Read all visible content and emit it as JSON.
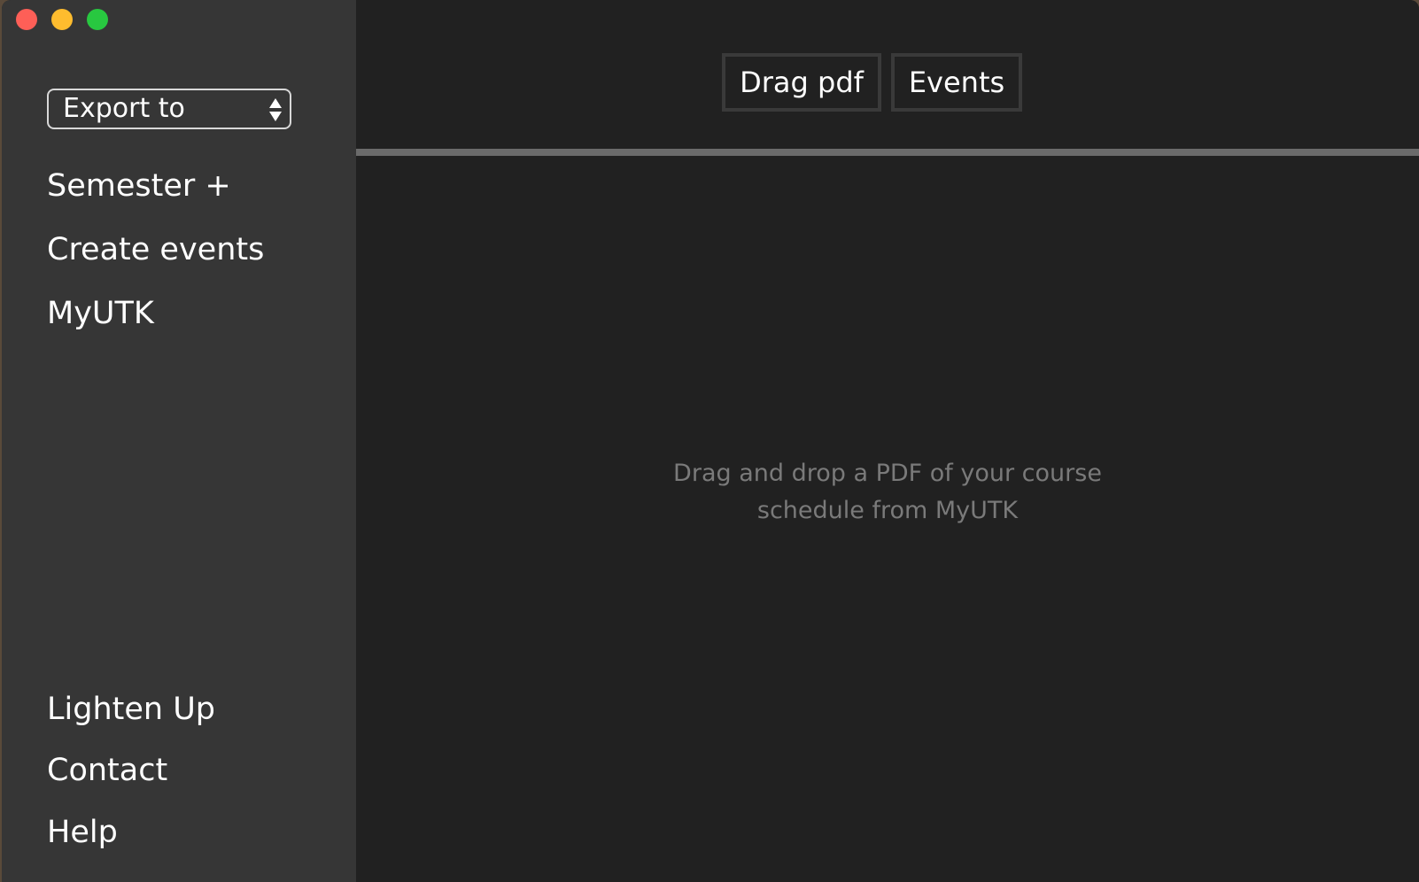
{
  "window": {
    "traffic_lights": [
      {
        "name": "close",
        "color": "#fe5f57"
      },
      {
        "name": "minimize",
        "color": "#febc2e"
      },
      {
        "name": "zoom",
        "color": "#28c840"
      }
    ]
  },
  "sidebar": {
    "export_select": {
      "label": "Export to"
    },
    "top_items": [
      {
        "label": "Semester +"
      },
      {
        "label": "Create events"
      },
      {
        "label": "MyUTK"
      }
    ],
    "bottom_items": [
      {
        "label": "Lighten Up"
      },
      {
        "label": "Contact"
      },
      {
        "label": "Help"
      }
    ]
  },
  "main": {
    "tabs": [
      {
        "label": "Drag pdf"
      },
      {
        "label": "Events"
      }
    ],
    "drop_hint": {
      "line1": "Drag and drop a PDF of your course",
      "line2": "schedule from MyUTK"
    }
  },
  "colors": {
    "sidebar_bg": "#363636",
    "main_bg": "#212121",
    "divider": "#6b6b6b",
    "hint_text": "#7a7a7a"
  }
}
